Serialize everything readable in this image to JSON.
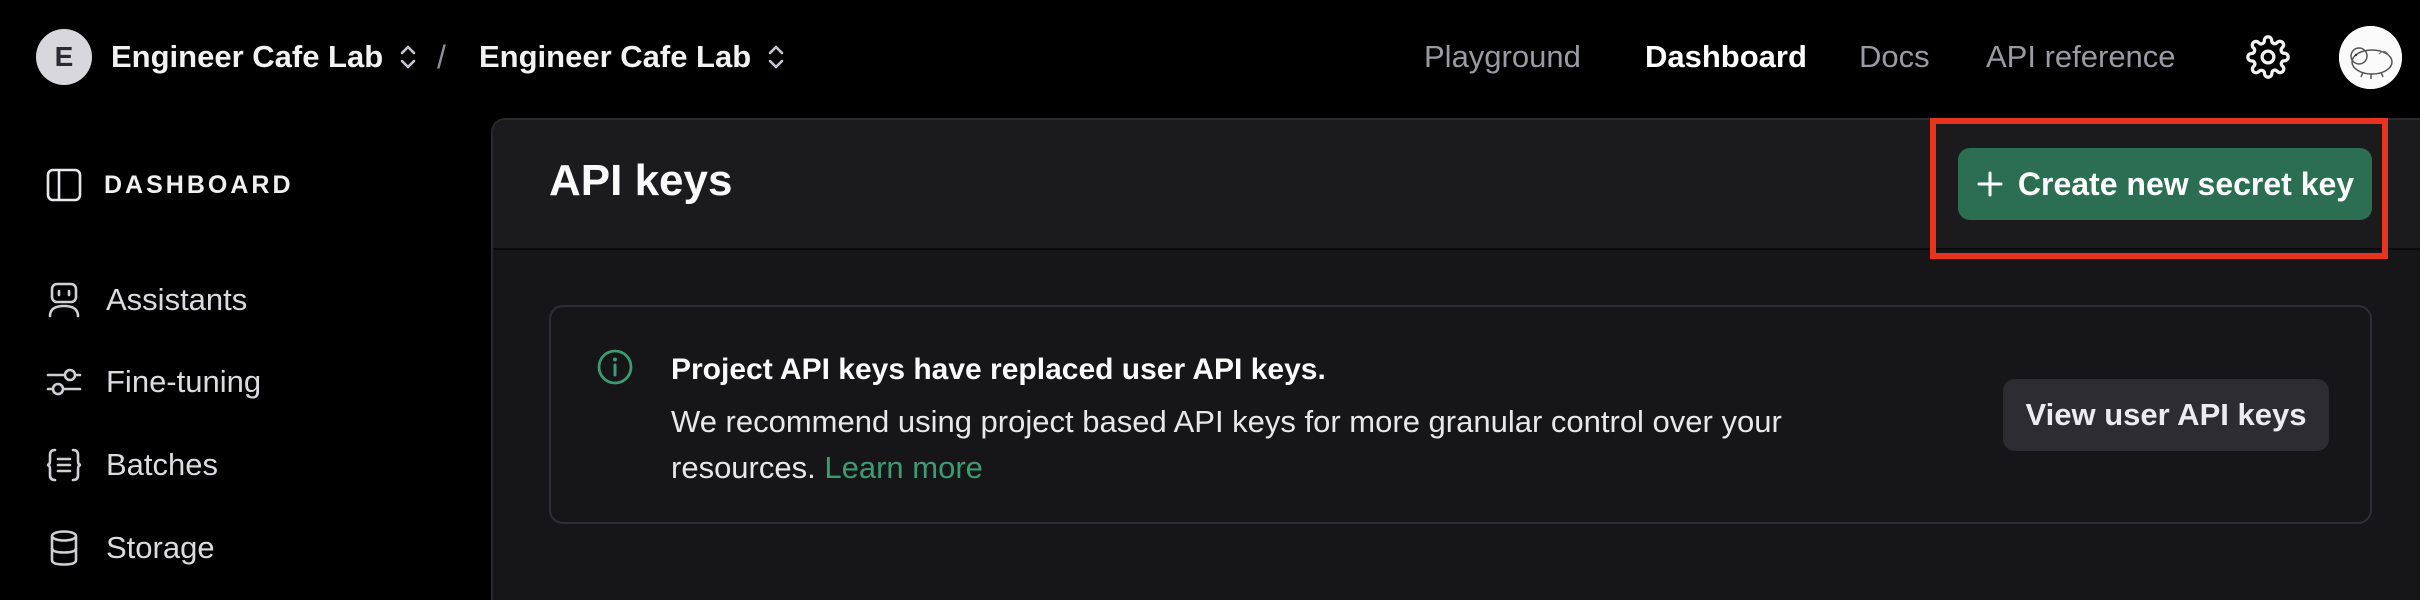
{
  "header": {
    "org_initial": "E",
    "org_name": "Engineer Cafe Lab",
    "separator": "/",
    "project_name": "Engineer Cafe Lab",
    "nav": {
      "playground": "Playground",
      "dashboard": "Dashboard",
      "docs": "Docs",
      "api_reference": "API reference"
    },
    "active_nav": "Dashboard"
  },
  "sidebar": {
    "section_label": "DASHBOARD",
    "items": [
      {
        "label": "Assistants",
        "icon": "robot-icon"
      },
      {
        "label": "Fine-tuning",
        "icon": "sliders-icon"
      },
      {
        "label": "Batches",
        "icon": "braces-icon"
      },
      {
        "label": "Storage",
        "icon": "database-icon"
      }
    ]
  },
  "main": {
    "title": "API keys",
    "create_button_label": "Create new secret key",
    "notice": {
      "title": "Project API keys have replaced user API keys.",
      "body": "We recommend using project based API keys for more granular control over your resources.",
      "link_label": "Learn more",
      "button_label": "View user API keys"
    }
  },
  "colors": {
    "background": "#000000",
    "panel": "#161618",
    "primary_button": "#2c6e52",
    "link": "#3c9b73",
    "highlight": "#e8341f"
  }
}
